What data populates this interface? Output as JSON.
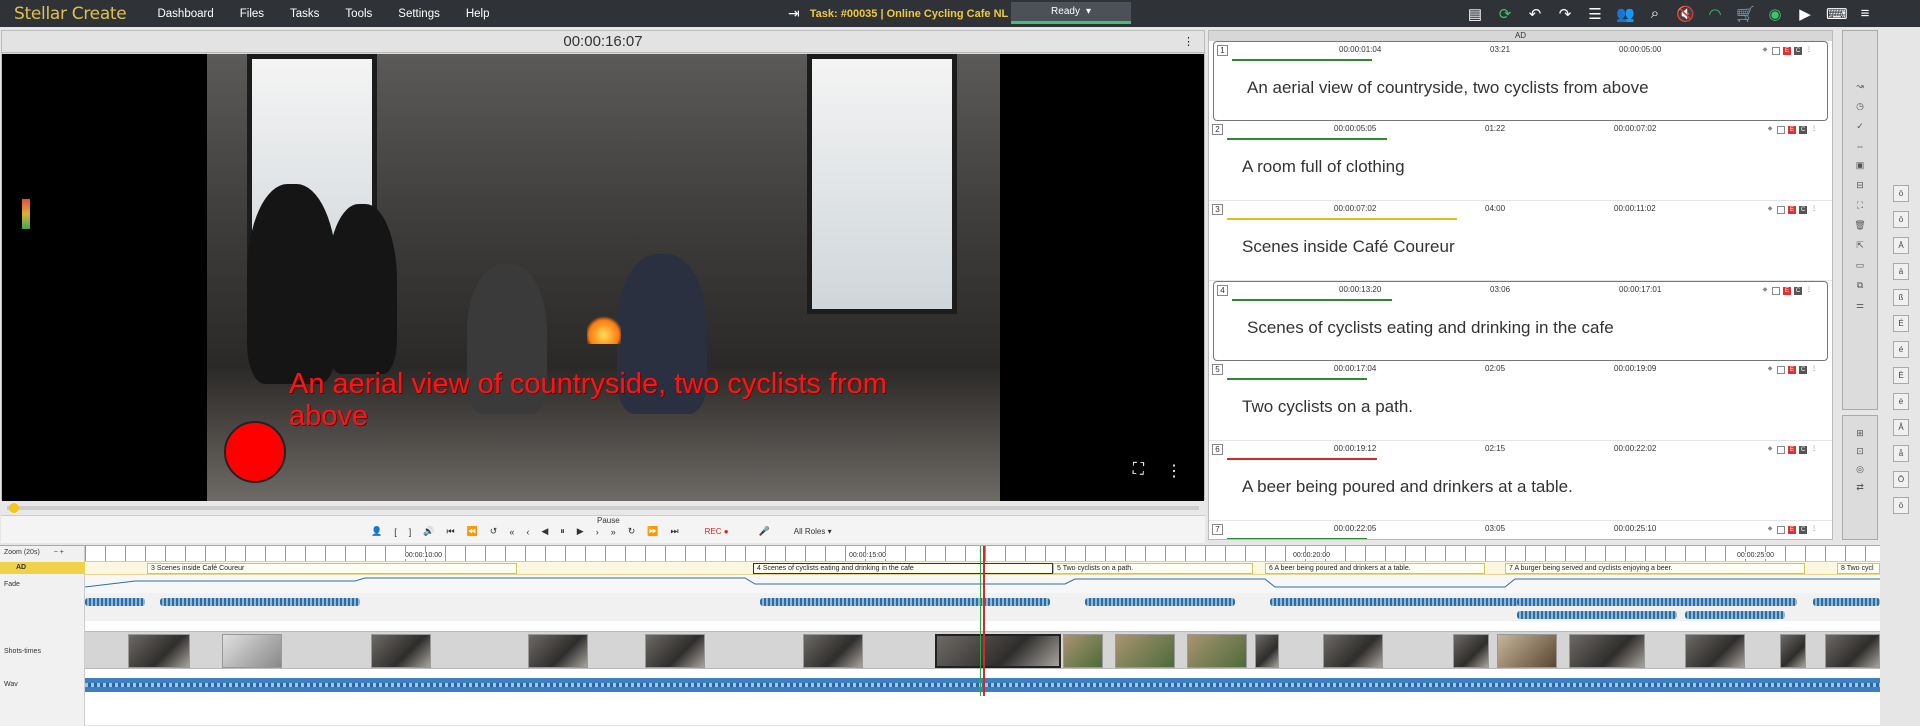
{
  "app": {
    "brand": "Stellar Create"
  },
  "menu": [
    "Dashboard",
    "Files",
    "Tasks",
    "Tools",
    "Settings",
    "Help"
  ],
  "task": {
    "title": "Task: #00035 | Online Cycling Cafe NL",
    "status": "Ready"
  },
  "toolbar_icons": [
    "note-icon",
    "sync-icon",
    "undo-icon",
    "redo-icon",
    "list-icon",
    "users-icon",
    "search-icon",
    "mute-icon",
    "wifi-icon",
    "cart-icon",
    "user-circle-icon",
    "play-icon",
    "keyboard-icon",
    "menu-icon"
  ],
  "player": {
    "timecode": "00:00:16:07",
    "subtitle": "An aerial view of countryside, two cyclists from above",
    "transport_label": "Pause",
    "rec_label": "REC",
    "roles_label": "All Roles"
  },
  "ad_panel": {
    "header": "AD",
    "items": [
      {
        "num": "1",
        "in": "00:00:01:04",
        "dur": "03:21",
        "out": "00:00:05:00",
        "text": "An aerial view of countryside, two cyclists from above",
        "color": "#2e8b2e"
      },
      {
        "num": "2",
        "in": "00:00:05:05",
        "dur": "01:22",
        "out": "00:00:07:02",
        "text": "A room full of clothing",
        "color": "#2e8b2e"
      },
      {
        "num": "3",
        "in": "00:00:07:02",
        "dur": "04:00",
        "out": "00:00:11:02",
        "text": "Scenes inside Café Coureur",
        "color": "#d9c21a"
      },
      {
        "num": "4",
        "in": "00:00:13:20",
        "dur": "03:06",
        "out": "00:00:17:01",
        "text": "Scenes of cyclists eating and drinking in the cafe",
        "color": "#2e8b2e"
      },
      {
        "num": "5",
        "in": "00:00:17:04",
        "dur": "02:05",
        "out": "00:00:19:09",
        "text": "Two cyclists on a path.",
        "color": "#2e8b2e"
      },
      {
        "num": "6",
        "in": "00:00:19:12",
        "dur": "02:15",
        "out": "00:00:22:02",
        "text": "A beer being poured and drinkers at a table.",
        "color": "#d62828"
      },
      {
        "num": "7",
        "in": "00:00:22:05",
        "dur": "03:05",
        "out": "00:00:25:10",
        "text": "",
        "color": "#2e8b2e"
      }
    ]
  },
  "timeline": {
    "zoom_label": "Zoom (20s)",
    "track_labels": {
      "ad": "AD",
      "fade": "Fade",
      "shots": "Shots-times",
      "wav": "Wav"
    },
    "ruler": [
      "00:00:10:00",
      "00:00:15:00",
      "00:00:20:00",
      "00:00:25:00"
    ],
    "ad_blocks": [
      {
        "label": "3 Scenes inside Café Coureur"
      },
      {
        "label": "4 Scenes of cyclists eating and drinking in the cafe"
      },
      {
        "label": "5 Two cyclists on a path."
      },
      {
        "label": "6 A beer being poured and drinkers at a table."
      },
      {
        "label": "7 A burger being served and cyclists enjoying a beer."
      },
      {
        "label": "8 Two cycl"
      }
    ]
  }
}
